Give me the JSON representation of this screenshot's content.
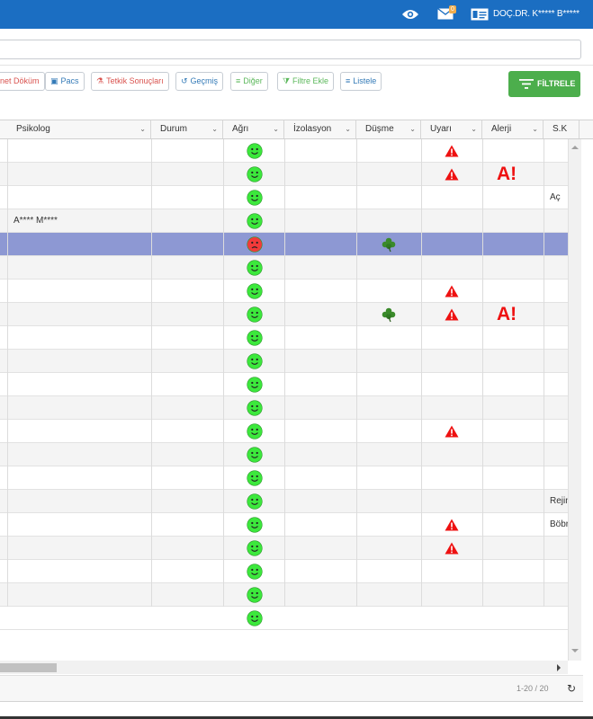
{
  "header": {
    "user_name": "DOÇ.DR. K***** B*****",
    "mail_count": "0",
    "colors": {
      "bar": "#1b6ec2",
      "accent": "#4cae4c"
    }
  },
  "toolbar": {
    "buttons": [
      {
        "label": "net Döküm",
        "icon": "document-icon",
        "color": "#d9534f"
      },
      {
        "label": "Pacs",
        "icon": "image-icon",
        "color": "#337ab7"
      },
      {
        "label": "Tetkik Sonuçları",
        "icon": "flask-icon",
        "color": "#d9534f"
      },
      {
        "label": "Geçmiş",
        "icon": "history-icon",
        "color": "#337ab7"
      },
      {
        "label": "Diğer",
        "icon": "list-icon",
        "color": "#5cb85c"
      },
      {
        "label": "Filtre Ekle",
        "icon": "funnel-icon",
        "color": "#5cb85c"
      },
      {
        "label": "Listele",
        "icon": "list-icon",
        "color": "#337ab7"
      }
    ],
    "filter_label": "FİLTRELE"
  },
  "grid": {
    "columns": [
      "Psikolog",
      "Durum",
      "Ağrı",
      "İzolasyon",
      "Düşme",
      "Uyarı",
      "Alerji",
      "S.K"
    ],
    "rows": [
      {
        "psikolog": "",
        "pain": "green",
        "fall": false,
        "warning": true,
        "allergy": false,
        "note": ""
      },
      {
        "psikolog": "",
        "pain": "green",
        "fall": false,
        "warning": true,
        "allergy": true,
        "note": ""
      },
      {
        "psikolog": "",
        "pain": "green",
        "fall": false,
        "warning": false,
        "allergy": false,
        "note": "Aç"
      },
      {
        "psikolog": "A**** M****",
        "pain": "green",
        "fall": false,
        "warning": false,
        "allergy": false,
        "note": ""
      },
      {
        "psikolog": "",
        "pain": "red",
        "fall": true,
        "warning": false,
        "allergy": false,
        "note": ""
      },
      {
        "psikolog": "",
        "pain": "green",
        "fall": false,
        "warning": false,
        "allergy": false,
        "note": ""
      },
      {
        "psikolog": "",
        "pain": "green",
        "fall": false,
        "warning": true,
        "allergy": false,
        "note": ""
      },
      {
        "psikolog": "",
        "pain": "green",
        "fall": true,
        "warning": true,
        "allergy": true,
        "note": ""
      },
      {
        "psikolog": "",
        "pain": "green",
        "fall": false,
        "warning": false,
        "allergy": false,
        "note": ""
      },
      {
        "psikolog": "",
        "pain": "green",
        "fall": false,
        "warning": false,
        "allergy": false,
        "note": ""
      },
      {
        "psikolog": "",
        "pain": "green",
        "fall": false,
        "warning": false,
        "allergy": false,
        "note": ""
      },
      {
        "psikolog": "",
        "pain": "green",
        "fall": false,
        "warning": false,
        "allergy": false,
        "note": ""
      },
      {
        "psikolog": "",
        "pain": "green",
        "fall": false,
        "warning": true,
        "allergy": false,
        "note": ""
      },
      {
        "psikolog": "",
        "pain": "green",
        "fall": false,
        "warning": false,
        "allergy": false,
        "note": ""
      },
      {
        "psikolog": "",
        "pain": "green",
        "fall": false,
        "warning": false,
        "allergy": false,
        "note": ""
      },
      {
        "psikolog": "",
        "pain": "green",
        "fall": false,
        "warning": false,
        "allergy": false,
        "note": "Rejin"
      },
      {
        "psikolog": "",
        "pain": "green",
        "fall": false,
        "warning": true,
        "allergy": false,
        "note": "Böbr"
      },
      {
        "psikolog": "",
        "pain": "green",
        "fall": false,
        "warning": true,
        "allergy": false,
        "note": ""
      },
      {
        "psikolog": "",
        "pain": "green",
        "fall": false,
        "warning": false,
        "allergy": false,
        "note": ""
      },
      {
        "psikolog": "",
        "pain": "green",
        "fall": false,
        "warning": false,
        "allergy": false,
        "note": ""
      },
      {
        "psikolog": "",
        "pain": "green",
        "fall": false,
        "warning": false,
        "allergy": false,
        "note": ""
      }
    ],
    "allergy_mark": "A!",
    "selected_row": 4
  },
  "footer": {
    "pager": "1-20 / 20"
  }
}
